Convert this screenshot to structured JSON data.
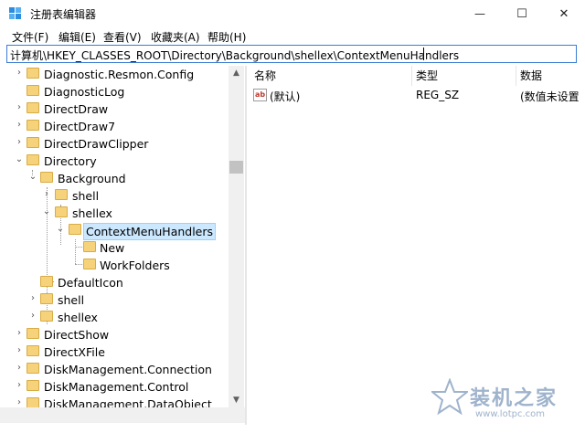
{
  "window": {
    "title": "注册表编辑器",
    "controls": {
      "minimize": "—",
      "maximize": "☐",
      "close": "✕"
    }
  },
  "menu": [
    "文件(F)",
    "编辑(E)",
    "查看(V)",
    "收藏夹(A)",
    "帮助(H)"
  ],
  "address": "计算机\\HKEY_CLASSES_ROOT\\Directory\\Background\\shellex\\ContextMenuHandlers",
  "tree": [
    {
      "label": "Diagnostic.Resmon.Config",
      "level": 0,
      "expander": "›"
    },
    {
      "label": "DiagnosticLog",
      "level": 0,
      "expander": ""
    },
    {
      "label": "DirectDraw",
      "level": 0,
      "expander": "›"
    },
    {
      "label": "DirectDraw7",
      "level": 0,
      "expander": "›"
    },
    {
      "label": "DirectDrawClipper",
      "level": 0,
      "expander": "›"
    },
    {
      "label": "Directory",
      "level": 0,
      "expander": "⌄"
    },
    {
      "label": "Background",
      "level": 1,
      "expander": "⌄"
    },
    {
      "label": "shell",
      "level": 2,
      "expander": "›"
    },
    {
      "label": "shellex",
      "level": 2,
      "expander": "⌄"
    },
    {
      "label": "ContextMenuHandlers",
      "level": 3,
      "expander": "⌄",
      "selected": true
    },
    {
      "label": "New",
      "level": 4,
      "expander": ""
    },
    {
      "label": "WorkFolders",
      "level": 4,
      "expander": ""
    },
    {
      "label": "DefaultIcon",
      "level": 1,
      "expander": ""
    },
    {
      "label": "shell",
      "level": 1,
      "expander": "›"
    },
    {
      "label": "shellex",
      "level": 1,
      "expander": "›"
    },
    {
      "label": "DirectShow",
      "level": 0,
      "expander": "›"
    },
    {
      "label": "DirectXFile",
      "level": 0,
      "expander": "›"
    },
    {
      "label": "DiskManagement.Connection",
      "level": 0,
      "expander": "›"
    },
    {
      "label": "DiskManagement.Control",
      "level": 0,
      "expander": "›"
    },
    {
      "label": "DiskManagement.DataObject",
      "level": 0,
      "expander": "›"
    }
  ],
  "columns": {
    "name": "名称",
    "type": "类型",
    "data": "数据"
  },
  "values": [
    {
      "icon": "ab",
      "name": "(默认)",
      "type": "REG_SZ",
      "data": "(数值未设置"
    }
  ],
  "watermark": {
    "text": "装机之家",
    "url": "www.lotpc.com"
  },
  "colors": {
    "folder": "#f6d27a",
    "selection": "#cce8ff",
    "accent": "#3a7bd5"
  }
}
